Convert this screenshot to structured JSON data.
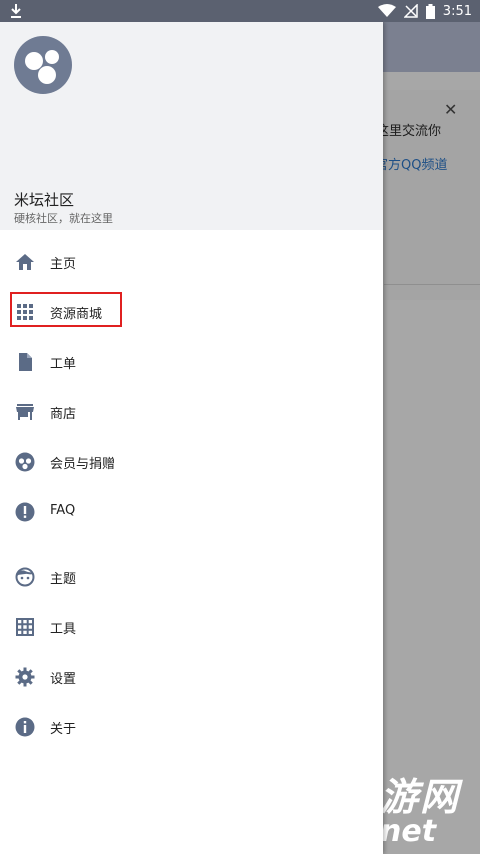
{
  "status_bar": {
    "time": "3:51"
  },
  "drawer": {
    "title": "米坛社区",
    "subtitle": "硬核社区，就在这里",
    "menu_items": [
      {
        "label": "主页",
        "icon": "home-icon"
      },
      {
        "label": "资源商城",
        "icon": "apps-grid-icon"
      },
      {
        "label": "工单",
        "icon": "document-icon"
      },
      {
        "label": "商店",
        "icon": "store-icon"
      },
      {
        "label": "会员与捐赠",
        "icon": "donate-icon"
      },
      {
        "label": "FAQ",
        "icon": "alert-circle-icon"
      },
      {
        "label": "主题",
        "icon": "face-icon"
      },
      {
        "label": "工具",
        "icon": "grid-table-icon"
      },
      {
        "label": "设置",
        "icon": "gear-icon"
      },
      {
        "label": "关于",
        "icon": "info-icon"
      }
    ]
  },
  "background": {
    "card_text_1": "这里交流你",
    "card_text_2": "官方QQ频道"
  },
  "watermark": {
    "line1": "游网",
    "line2": "net"
  },
  "colors": {
    "icon": "#5b6b86",
    "highlight": "#e02020",
    "header_bg": "#f1f2f4"
  }
}
